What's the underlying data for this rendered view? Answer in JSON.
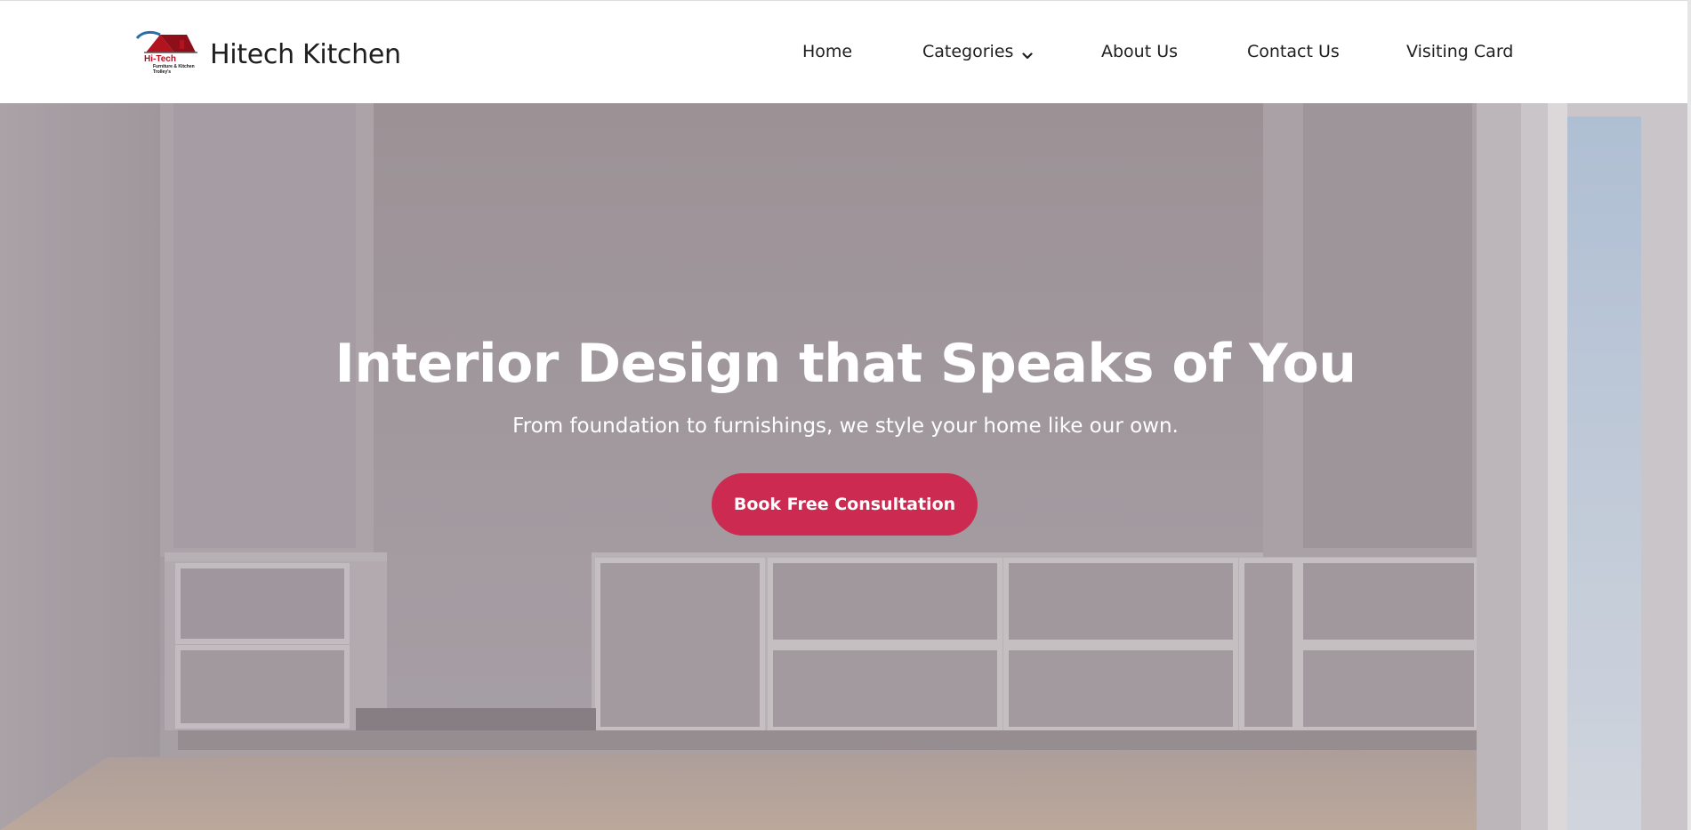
{
  "brand": {
    "name": "Hitech Kitchen",
    "logo_main": "Hi-Tech",
    "logo_sub": "Furniture & Kitchen Trolley's"
  },
  "nav": {
    "items": [
      {
        "label": "Home"
      },
      {
        "label": "Categories"
      },
      {
        "label": "About Us"
      },
      {
        "label": "Contact Us"
      },
      {
        "label": "Visiting Card"
      }
    ]
  },
  "hero": {
    "title": "Interior Design that Speaks of You",
    "subtitle": "From foundation to furnishings, we style your home like our own.",
    "cta_label": "Book Free Consultation"
  },
  "colors": {
    "accent": "#cc2a50",
    "logo_red": "#b3121f",
    "text_dark": "#1f1f1f"
  },
  "icons": {
    "dropdown": "chevron-down-icon",
    "logo": "house-roof-logo"
  }
}
